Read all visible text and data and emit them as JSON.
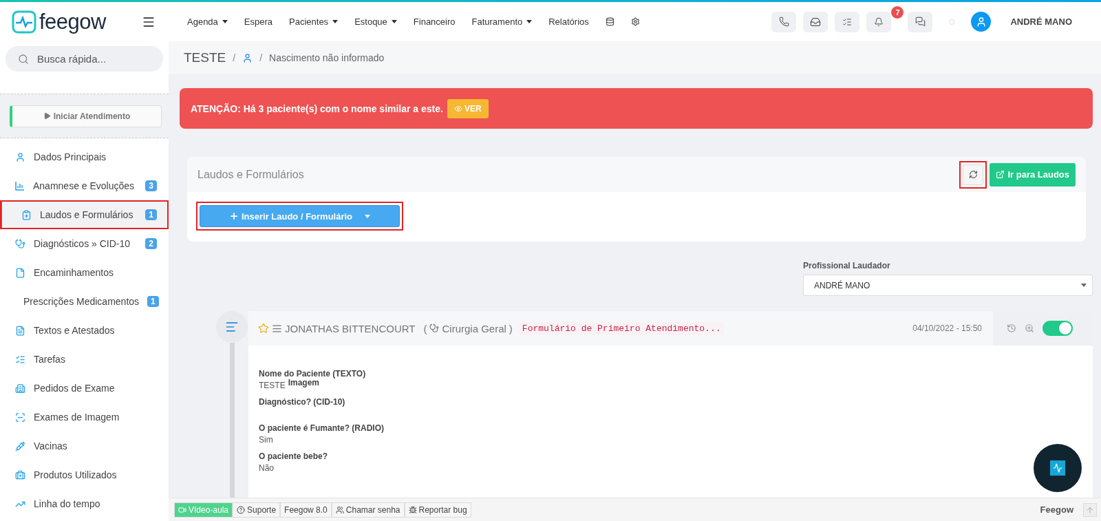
{
  "top_nav": {
    "brand": "feegow",
    "menu": [
      {
        "label": "Agenda",
        "dropdown": true
      },
      {
        "label": "Espera",
        "dropdown": false
      },
      {
        "label": "Pacientes",
        "dropdown": true
      },
      {
        "label": "Estoque",
        "dropdown": true
      },
      {
        "label": "Financeiro",
        "dropdown": false
      },
      {
        "label": "Faturamento",
        "dropdown": true
      },
      {
        "label": "Relatórios",
        "dropdown": false
      }
    ],
    "notification_count": "7",
    "user_name": "ANDRÉ MANO"
  },
  "sidebar": {
    "search_placeholder": "Busca rápida...",
    "start_button": "Iniciar Atendimento",
    "items": [
      {
        "label": "Dados Principais",
        "selected": false,
        "highlighted": false
      },
      {
        "label": "Anamnese e Evoluções",
        "badge": "3",
        "selected": false,
        "highlighted": false
      },
      {
        "label": "Laudos e Formulários",
        "badge": "1",
        "selected": true,
        "highlighted": true
      },
      {
        "label": "Diagnósticos » CID-10",
        "badge": "2",
        "selected": false,
        "highlighted": false
      },
      {
        "label": "Encaminhamentos",
        "selected": false,
        "highlighted": false
      },
      {
        "label": "Prescrições Medicamentos",
        "badge": "1",
        "selected": false,
        "highlighted": false
      },
      {
        "label": "Textos e Atestados",
        "selected": false,
        "highlighted": false
      },
      {
        "label": "Tarefas",
        "selected": false,
        "highlighted": false
      },
      {
        "label": "Pedidos de Exame",
        "selected": false,
        "highlighted": false
      },
      {
        "label": "Exames de Imagem",
        "selected": false,
        "highlighted": false
      },
      {
        "label": "Vacinas",
        "selected": false,
        "highlighted": false
      },
      {
        "label": "Produtos Utilizados",
        "selected": false,
        "highlighted": false
      },
      {
        "label": "Linha do tempo",
        "selected": false,
        "highlighted": false
      }
    ]
  },
  "breadcrumb": {
    "patient": "TESTE",
    "separator_1": "/",
    "separator_2": "/",
    "birth": "Nascimento não informado"
  },
  "alert": {
    "text": "ATENÇÃO: Há 3 paciente(s) com o nome similar a este.",
    "button": "VER"
  },
  "panel": {
    "title": "Laudos e Formulários",
    "refresh_highlighted": true,
    "go_button": "Ir para Laudos",
    "insert_button": "Inserir Laudo / Formulário",
    "insert_highlighted": true
  },
  "professional_select": {
    "label": "Profissional Laudador",
    "value": "ANDRÉ MANO"
  },
  "entry": {
    "author": "JONATHAS BITTENCOURT",
    "open_paren": "(",
    "specialty": "Cirurgia Geral",
    "close_paren": ")",
    "form_name": "Formulário de Primeiro Atendimento...",
    "date": "04/10/2022 - 15:50",
    "on": true,
    "fields": [
      {
        "label": "Nome do Paciente (TEXTO)",
        "value": "TESTE",
        "trailing_label": "Imagem"
      },
      {
        "label": "Diagnóstico? (CID-10)"
      },
      {
        "label": "O paciente é Fumante? (RADIO)",
        "value": "Sim"
      },
      {
        "label": "O paciente bebe?",
        "value": "Não"
      }
    ]
  },
  "footer": {
    "buttons": [
      {
        "label": "Vídeo-aula",
        "kind": "video"
      },
      {
        "label": "Suporte",
        "kind": "help"
      },
      {
        "label": "Feegow 8.0",
        "kind": "plain"
      },
      {
        "label": "Chamar senha",
        "kind": "users"
      },
      {
        "label": "Reportar bug",
        "kind": "bug"
      }
    ],
    "brand": "Feegow"
  }
}
